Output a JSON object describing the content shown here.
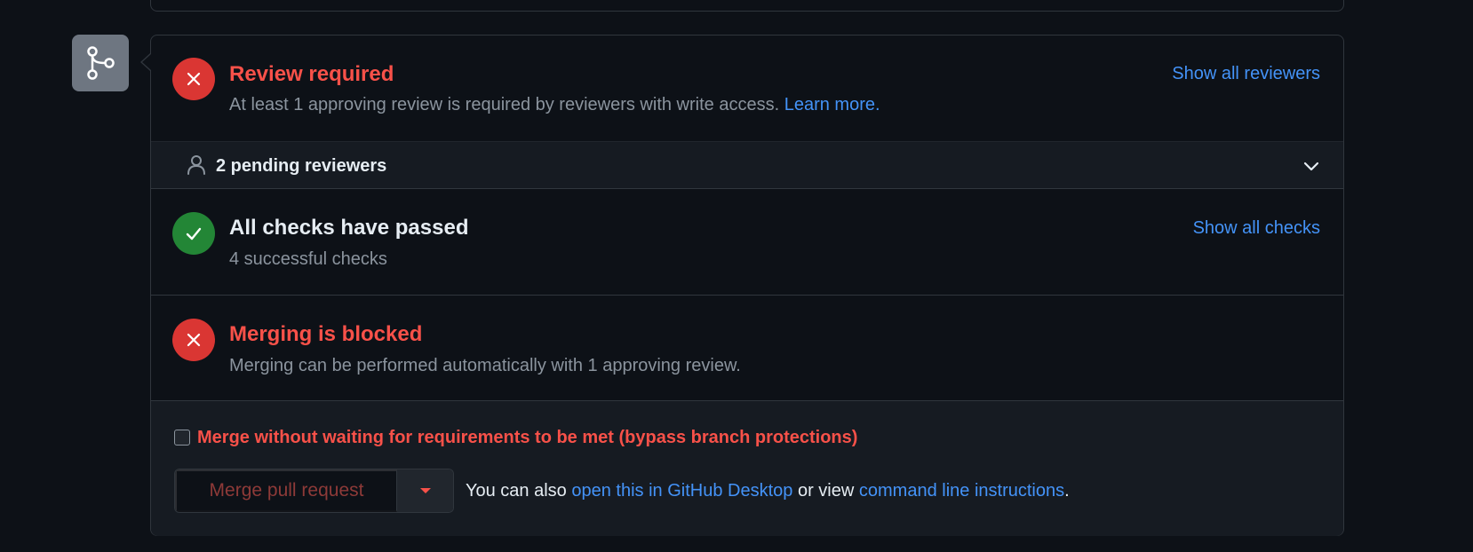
{
  "review": {
    "title": "Review required",
    "description": "At least 1 approving review is required by reviewers with write access.",
    "learn_more": "Learn more.",
    "show_all_reviewers": "Show all reviewers"
  },
  "pending": {
    "label": "2 pending reviewers"
  },
  "checks": {
    "title": "All checks have passed",
    "subtitle": "4 successful checks",
    "show_all_checks": "Show all checks"
  },
  "blocked": {
    "title": "Merging is blocked",
    "subtitle": "Merging can be performed automatically with 1 approving review."
  },
  "merge": {
    "bypass_label": "Merge without waiting for requirements to be met (bypass branch protections)",
    "bypass_checked": false,
    "button_label": "Merge pull request",
    "alt_prefix": "You can also",
    "desktop_link": "open this in GitHub Desktop",
    "alt_middle": "or view",
    "cli_link": "command line instructions",
    "alt_suffix": "."
  },
  "colors": {
    "background": "#0d1117",
    "danger": "#da3633",
    "danger_text": "#f85149",
    "success": "#238636",
    "link": "#4493f8",
    "muted": "#8b949e"
  },
  "icons": [
    "git-merge-icon",
    "x-circle-icon",
    "person-icon",
    "chevron-down-icon",
    "check-circle-icon",
    "triangle-down-icon"
  ]
}
